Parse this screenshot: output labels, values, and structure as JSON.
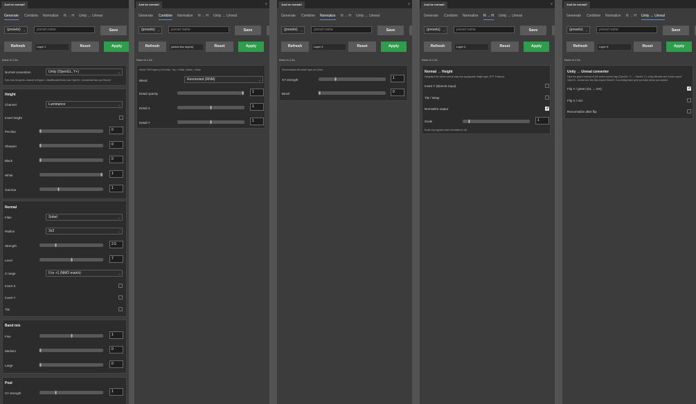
{
  "app": {
    "window_title": "Just be normal!",
    "menu_icon": "hamburger-icon"
  },
  "tabs": [
    "Generate",
    "Combine",
    "Normalize",
    "N → H",
    "Unity ↔ Unreal"
  ],
  "presets": {
    "selected": "(presets)",
    "placeholder": "preset name",
    "save_label": "Save"
  },
  "actions": {
    "refresh": "Refresh",
    "reset": "Reset",
    "apply": "Apply"
  },
  "status": "Done in 1.2s.",
  "windows": [
    {
      "active_tab": "Generate",
      "layer": "Layer 1",
      "convention": {
        "label": "Normal convention",
        "value": "Unity (OpenGL, Y+)",
        "hint": "Sets how the green channel is flipped. Unity/Blender/Godot use OpenGL; Unreal/3ds Max use DirectX."
      },
      "height": {
        "title": "Height",
        "channel_label": "Channel",
        "channel_value": "Luminance",
        "invert_label": "Invert height",
        "invert": false,
        "sliders": [
          {
            "label": "Pre-blur",
            "value": "0",
            "level": 0.02
          },
          {
            "label": "Sharpen",
            "value": "0",
            "level": 0.02
          },
          {
            "label": "Black",
            "value": "0",
            "level": 0.02
          },
          {
            "label": "White",
            "value": "1",
            "level": 0.97
          },
          {
            "label": "Gamma",
            "value": "1",
            "level": 0.3
          }
        ]
      },
      "normal": {
        "title": "Normal",
        "filter_label": "Filter",
        "filter_value": "Sobel",
        "radius_label": "Radius",
        "radius_value": "3x3",
        "sliders": [
          {
            "label": "Strength",
            "value": "2.5",
            "level": 0.25
          },
          {
            "label": "Level",
            "value": "7",
            "level": 0.5
          }
        ],
        "zrange_label": "Z range",
        "zrange_value": "0 to +1 (NMO match)",
        "checks": [
          {
            "label": "Invert X",
            "on": false
          },
          {
            "label": "Invert Y",
            "on": false
          },
          {
            "label": "Tile",
            "on": false
          }
        ]
      },
      "bandmix": {
        "title": "Band mix",
        "sliders": [
          {
            "label": "Fine",
            "value": "1",
            "level": 0.5
          },
          {
            "label": "Medium",
            "value": "0",
            "level": 0.02
          },
          {
            "label": "Large",
            "value": "0",
            "level": 0.02
          }
        ]
      },
      "post": {
        "title": "Post",
        "sliders": [
          {
            "label": "XY strength",
            "value": "1",
            "level": 0.25
          }
        ]
      }
    },
    {
      "active_tab": "Combine",
      "layer": "(select two layers)",
      "hint": "Select TWO layers (Ctrl+click). Top = Detail, bottom = Base.",
      "blend_label": "Blend",
      "blend_value": "Reoriented (RNM)",
      "sliders": [
        {
          "label": "Detail opacity",
          "value": "1",
          "level": 0.97
        },
        {
          "label": "Detail X",
          "value": "1",
          "level": 0.5
        },
        {
          "label": "Detail Y",
          "value": "1",
          "level": 0.5
        }
      ]
    },
    {
      "active_tab": "Normalize",
      "layer": "Layer 3",
      "hint": "Renormalizes the active layer per-pixel.",
      "sliders": [
        {
          "label": "XY strength",
          "value": "1",
          "level": 0.25
        },
        {
          "label": "Bevel",
          "value": "0",
          "level": 0.02
        }
      ]
    },
    {
      "active_tab": "N → H",
      "layer": "Layer 4",
      "title": "Normal → Height",
      "hint": "Integrates the active normal map into a grayscale height layer (FFT Poisson).",
      "checks": [
        {
          "label": "Invert Y (DirectX input)",
          "on": false
        },
        {
          "label": "Tile / Wrap",
          "on": false
        },
        {
          "label": "Normalize output",
          "on": true
        }
      ],
      "scale": {
        "label": "Scale",
        "value": "1",
        "level": 0.1
      },
      "note": "Scale only applies when Normalize is off."
    },
    {
      "active_tab": "Unity ↔ Unreal",
      "layer": "Layer 5",
      "title": "Unity ↔ Unreal converter",
      "hint": "Flips the green channel of the active normal map (OpenGL Y+ ↔ DirectX Y-). Unity, Blender and Godot expect OpenGL; Unreal and 3ds Max expect DirectX. Converting twice gets you back where you started.",
      "checks": [
        {
          "label": "Flip Y / green (GL ↔ DX)",
          "on": true
        },
        {
          "label": "Flip X / red",
          "on": false
        },
        {
          "label": "Renormalize after flip",
          "on": false
        }
      ]
    }
  ]
}
